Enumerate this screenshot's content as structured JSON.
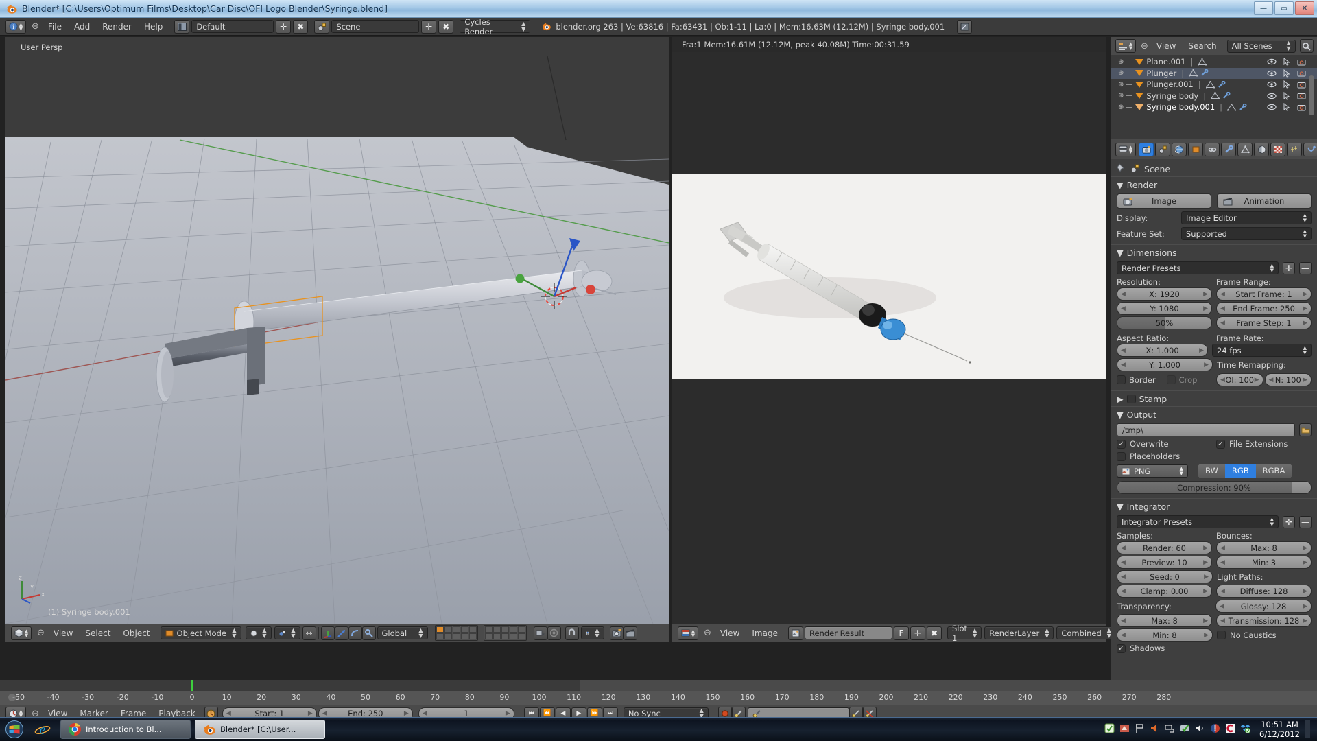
{
  "window": {
    "title": "Blender* [C:\\Users\\Optimum Films\\Desktop\\Car Disc\\OFI Logo Blender\\Syringe.blend]",
    "minimize": "—",
    "maximize": "▭",
    "close": "✕"
  },
  "info_header": {
    "menus": [
      "File",
      "Add",
      "Render",
      "Help"
    ],
    "screen_layout": "Default",
    "scene": "Scene",
    "engine": "Cycles Render",
    "stats": "blender.org 263 | Ve:63816 | Fa:63431 | Ob:1-11 | La:0 | Mem:16.63M (12.12M) | Syringe body.001"
  },
  "viewport": {
    "view_label": "User Persp",
    "active_object": "(1) Syringe body.001",
    "header": {
      "menus": [
        "View",
        "Select",
        "Object"
      ],
      "mode": "Object Mode",
      "orientation": "Global"
    }
  },
  "image_editor": {
    "render_info": "Fra:1  Mem:16.61M (12.12M, peak 40.08M) Time:00:31.59",
    "header": {
      "menus": [
        "View",
        "Image"
      ],
      "image_name": "Render Result",
      "fake_user": "F",
      "slot": "Slot 1",
      "render_layer": "RenderLayer",
      "pass": "Combined"
    }
  },
  "outliner": {
    "header": {
      "menus": [
        "View",
        "Search"
      ],
      "scene_filter": "All Scenes"
    },
    "items": [
      {
        "name": "Plane.001",
        "selected": false,
        "active": false,
        "has_modifier": false
      },
      {
        "name": "Plunger",
        "selected": true,
        "active": false,
        "has_modifier": true
      },
      {
        "name": "Plunger.001",
        "selected": false,
        "active": false,
        "has_modifier": true
      },
      {
        "name": "Syringe body",
        "selected": false,
        "active": false,
        "has_modifier": true
      },
      {
        "name": "Syringe body.001",
        "selected": false,
        "active": true,
        "has_modifier": true
      }
    ]
  },
  "properties": {
    "breadcrumb": "Scene",
    "render": {
      "title": "Render",
      "image_button": "Image",
      "animation_button": "Animation",
      "display_label": "Display:",
      "display_value": "Image Editor",
      "feature_set_label": "Feature Set:",
      "feature_set_value": "Supported"
    },
    "dimensions": {
      "title": "Dimensions",
      "presets": "Render Presets",
      "resolution_label": "Resolution:",
      "res_x": "X: 1920",
      "res_y": "Y: 1080",
      "res_percent": "50%",
      "res_percent_value": 50,
      "frame_range_label": "Frame Range:",
      "start_frame": "Start Frame: 1",
      "end_frame": "End Frame: 250",
      "frame_step": "Frame Step: 1",
      "aspect_label": "Aspect Ratio:",
      "aspect_x": "X: 1.000",
      "aspect_y": "Y: 1.000",
      "frame_rate_label": "Frame Rate:",
      "frame_rate": "24 fps",
      "time_remap_label": "Time Remapping:",
      "remap_old": "Ol: 100",
      "remap_new": "N: 100",
      "border": "Border",
      "crop": "Crop"
    },
    "stamp": {
      "title": "Stamp"
    },
    "output": {
      "title": "Output",
      "path": "/tmp\\",
      "overwrite": "Overwrite",
      "file_extensions": "File Extensions",
      "placeholders": "Placeholders",
      "format": "PNG",
      "color_modes": [
        "BW",
        "RGB",
        "RGBA"
      ],
      "color_mode_selected": "RGB",
      "compression": "Compression: 90%",
      "compression_value": 90
    },
    "integrator": {
      "title": "Integrator",
      "presets": "Integrator Presets",
      "samples_label": "Samples:",
      "render_samples": "Render: 60",
      "preview_samples": "Preview: 10",
      "seed": "Seed: 0",
      "clamp": "Clamp: 0.00",
      "transparency_label": "Transparency:",
      "transparency_max": "Max: 8",
      "transparency_min": "Min: 8",
      "shadows": "Shadows",
      "bounces_label": "Bounces:",
      "bounces_max": "Max: 8",
      "bounces_min": "Min: 3",
      "light_paths_label": "Light Paths:",
      "diffuse": "Diffuse: 128",
      "glossy": "Glossy: 128",
      "transmission": "Transmission: 128",
      "no_caustics": "No Caustics"
    }
  },
  "timeline": {
    "ruler_ticks": [
      "-50",
      "-40",
      "-30",
      "-20",
      "-10",
      "0",
      "10",
      "20",
      "30",
      "40",
      "50",
      "60",
      "70",
      "80",
      "90",
      "100",
      "110",
      "120",
      "130",
      "140",
      "150",
      "160",
      "170",
      "180",
      "190",
      "200",
      "210",
      "220",
      "230",
      "240",
      "250",
      "260",
      "270",
      "280"
    ],
    "menus": [
      "View",
      "Marker",
      "Frame",
      "Playback"
    ],
    "start": "Start: 1",
    "end": "End: 250",
    "current_frame": "1",
    "sync_mode": "No Sync"
  },
  "taskbar": {
    "tasks": [
      {
        "label": "Introduction to Bl...",
        "active": false,
        "icon": "chrome-icon"
      },
      {
        "label": "Blender* [C:\\User...",
        "active": true,
        "icon": "blender-icon"
      }
    ],
    "clock_time": "10:51 AM",
    "clock_date": "6/12/2012"
  },
  "colors": {
    "accent_blue": "#2f7fe0",
    "blender_orange": "#e8921f",
    "header_gray": "#4a4a4a",
    "panel_gray": "#3f3f3f"
  }
}
